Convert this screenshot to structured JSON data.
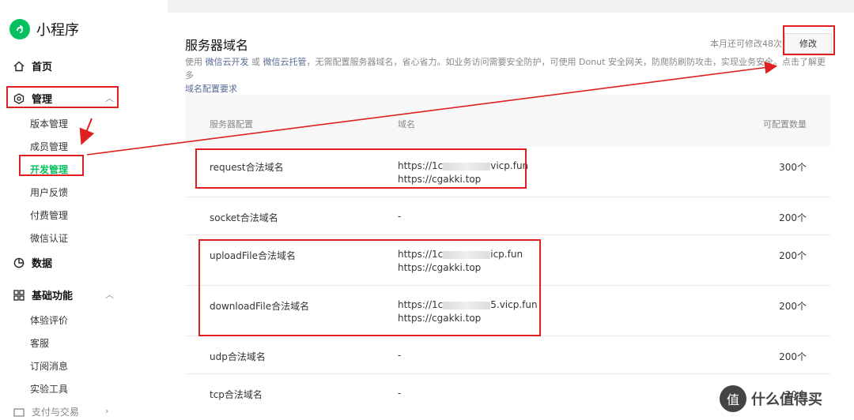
{
  "brand": {
    "title": "小程序"
  },
  "sidebar": {
    "home": "首页",
    "manage": "管理",
    "manage_items": [
      "版本管理",
      "成员管理",
      "开发管理",
      "用户反馈",
      "付费管理",
      "微信认证"
    ],
    "data": "数据",
    "basic": "基础功能",
    "basic_items": [
      "体验评价",
      "客服",
      "订阅消息",
      "实验工具"
    ],
    "pay": "支付与交易"
  },
  "header": {
    "title": "服务器域名",
    "quota": "本月还可修改48次",
    "edit_button": "修改",
    "desc_1": "使用",
    "desc_link_1": "微信云开发",
    "desc_or": "或",
    "desc_link_2": "微信云托管",
    "desc_2": "，无需配置服务器域名，省心省力。如业务访问需要安全防护，可使用 Donut 安全网关，防爬防刷防攻击，实现业务安全。点击了解更多",
    "desc_link_3": "域名配置要求"
  },
  "table": {
    "headers": {
      "config": "服务器配置",
      "domain": "域名",
      "count": "可配置数量"
    },
    "rows": [
      {
        "name": "request合法域名",
        "domain_1": "https://1c",
        "domain_1_tail": "vicp.fun",
        "domain_2": "https://cgakki.top",
        "count": "300个"
      },
      {
        "name": "socket合法域名",
        "domain_1": "-",
        "count": "200个"
      },
      {
        "name": "uploadFile合法域名",
        "domain_1": "https://1c",
        "domain_1_tail": "icp.fun",
        "domain_2": "https://cgakki.top",
        "count": "200个"
      },
      {
        "name": "downloadFile合法域名",
        "domain_1": "https://1c",
        "domain_1_tail": "5.vicp.fun",
        "domain_2": "https://cgakki.top",
        "count": "200个"
      },
      {
        "name": "udp合法域名",
        "domain_1": "-",
        "count": "200个"
      },
      {
        "name": "tcp合法域名",
        "domain_1": "-",
        "count": "20个"
      }
    ]
  },
  "watermark": {
    "glyph": "值",
    "text": "什么值得买"
  },
  "colors": {
    "accent": "#07c160",
    "link": "#576b95",
    "annotation": "#e02020"
  }
}
